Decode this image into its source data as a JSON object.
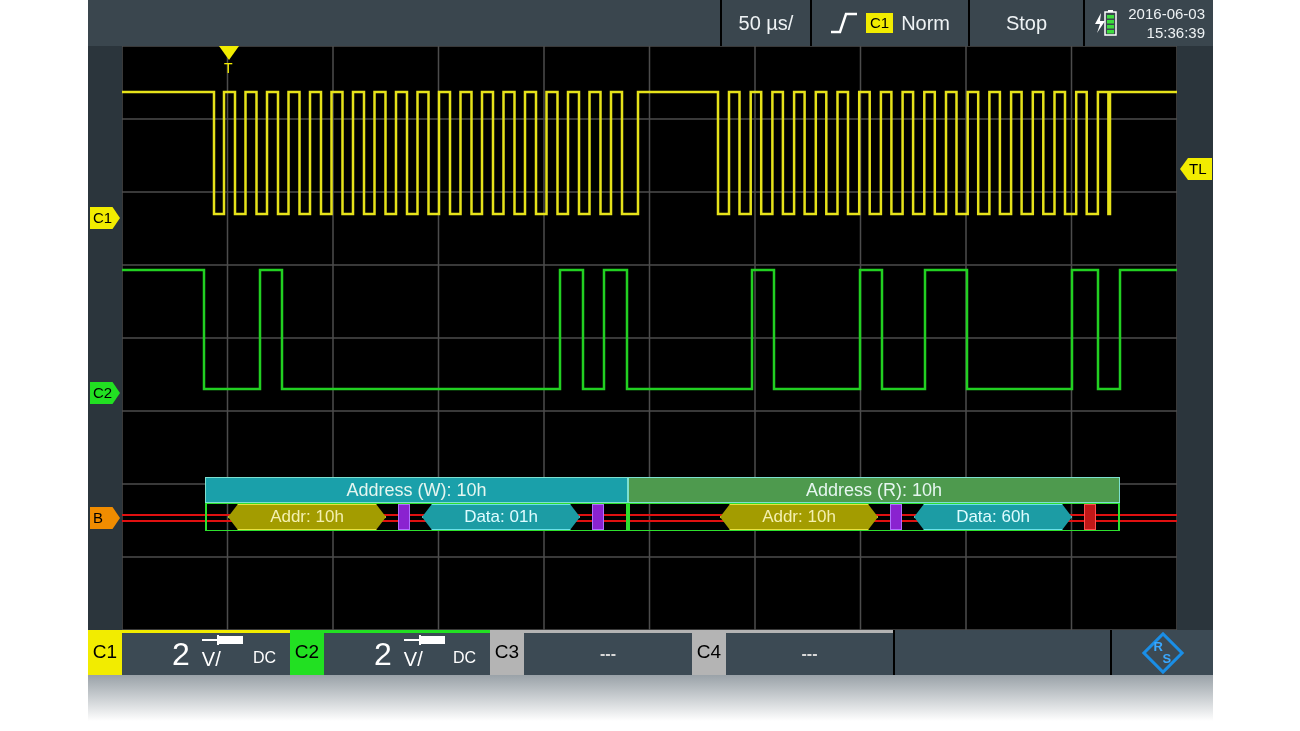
{
  "toolbar": {
    "timebase": "50 µs/",
    "trigger": {
      "source": "C1",
      "mode": "Norm"
    },
    "run_state": "Stop",
    "date": "2016-06-03",
    "time": "15:36:39"
  },
  "trigger_marker": {
    "label": "T"
  },
  "left_markers": [
    {
      "label": "C1",
      "color": "#f2ec00"
    },
    {
      "label": "C2",
      "color": "#22e022"
    },
    {
      "label": "B",
      "color": "#f08c00"
    }
  ],
  "right_markers": [
    {
      "label": "TL",
      "color": "#f2ec00"
    }
  ],
  "decode": {
    "frames": [
      {
        "label": "Address (W): 10h",
        "color": "#1aa0aa",
        "fields": [
          {
            "kind": "address",
            "label": "Addr: 10h"
          },
          {
            "kind": "ack"
          },
          {
            "kind": "data",
            "label": "Data: 01h"
          },
          {
            "kind": "ack"
          }
        ]
      },
      {
        "label": "Address (R): 10h",
        "color": "#4e9a4e",
        "fields": [
          {
            "kind": "address",
            "label": "Addr: 10h"
          },
          {
            "kind": "ack"
          },
          {
            "kind": "data",
            "label": "Data: 60h"
          },
          {
            "kind": "nack"
          }
        ]
      }
    ]
  },
  "channels": [
    {
      "kind": "on",
      "label": "C1",
      "color": "#f2ec00",
      "scale": "2",
      "unit": "V/",
      "coupling": "DC"
    },
    {
      "kind": "on",
      "label": "C2",
      "color": "#22e022",
      "scale": "2",
      "unit": "V/",
      "coupling": "DC"
    },
    {
      "kind": "off",
      "label": "C3",
      "color": "#b4b4b4",
      "reading": "---"
    },
    {
      "kind": "off",
      "label": "C4",
      "color": "#b4b4b4",
      "reading": "---"
    }
  ],
  "logo": {
    "upper": "R",
    "lower": "S"
  }
}
